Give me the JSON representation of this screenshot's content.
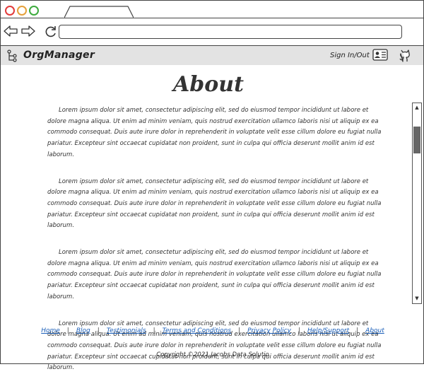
{
  "browser": {
    "url": ""
  },
  "header": {
    "brand": "OrgManager",
    "sign_in": "Sign In/Out"
  },
  "main": {
    "title": "About",
    "paragraphs": [
      "Lorem ipsum dolor sit amet, consectetur adipiscing elit, sed do eiusmod tempor incididunt ut labore et dolore magna aliqua. Ut enim ad minim veniam, quis nostrud exercitation ullamco laboris nisi ut aliquip ex ea commodo consequat. Duis aute irure dolor in reprehenderit in voluptate velit esse cillum dolore eu fugiat nulla pariatur. Excepteur sint occaecat cupidatat non proident, sunt in culpa qui officia deserunt mollit anim id est laborum.",
      "Lorem ipsum dolor sit amet, consectetur adipiscing elit, sed do eiusmod tempor incididunt ut labore et dolore magna aliqua. Ut enim ad minim veniam, quis nostrud exercitation ullamco laboris nisi ut aliquip ex ea commodo consequat. Duis aute irure dolor in reprehenderit in voluptate velit esse cillum dolore eu fugiat nulla pariatur. Excepteur sint occaecat cupidatat non proident, sunt in culpa qui officia deserunt mollit anim id est laborum.",
      "Lorem ipsum dolor sit amet, consectetur adipiscing elit, sed do eiusmod tempor incididunt ut labore et dolore magna aliqua. Ut enim ad minim veniam, quis nostrud exercitation ullamco laboris nisi ut aliquip ex ea commodo consequat. Duis aute irure dolor in reprehenderit in voluptate velit esse cillum dolore eu fugiat nulla pariatur. Excepteur sint occaecat cupidatat non proident, sunt in culpa qui officia deserunt mollit anim id est laborum.",
      "Lorem ipsum dolor sit amet, consectetur adipiscing elit, sed do eiusmod tempor incididunt ut labore et dolore magna aliqua. Ut enim ad minim veniam, quis nostrud exercitation ullamco laboris nisi ut aliquip ex ea commodo consequat. Duis aute irure dolor in reprehenderit in voluptate velit esse cillum dolore eu fugiat nulla pariatur. Excepteur sint occaecat cupidatat non proident, sunt in culpa qui officia deserunt mollit anim id est laborum."
    ]
  },
  "footer": {
    "links": [
      "Home",
      "Blog",
      "Testimonials",
      "Terms and Conditions",
      "Privacy Policy",
      "Help/Support",
      "About"
    ],
    "copyright": "Copyright ©2021 Jacobs Data Solutio"
  },
  "colors": {
    "link": "#1a5eb8",
    "header_bg": "#e3e3e3",
    "close": "#e23b3b",
    "minimize": "#e5a03a",
    "maximize": "#3daa3d"
  },
  "icons": [
    "back-arrow-icon",
    "forward-arrow-icon",
    "reload-icon",
    "org-tree-icon",
    "profile-card-icon",
    "github-octocat-icon"
  ]
}
